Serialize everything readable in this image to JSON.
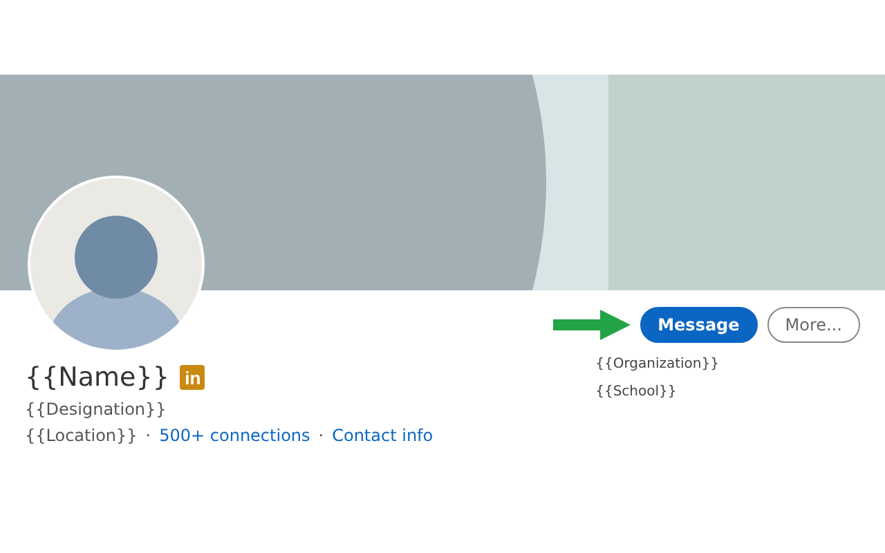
{
  "profile": {
    "name": "{{Name}}",
    "badge": "in",
    "designation": "{{Designation}}",
    "location": "{{Location}}",
    "separator_1": "·",
    "connections": "500+ connections",
    "separator_2": "·",
    "contact_info": "Contact info"
  },
  "actions": [
    {
      "label": "Message",
      "kind": "primary"
    },
    {
      "label": "More...",
      "kind": "secondary"
    }
  ],
  "details": [
    "{{Organization}}",
    "{{School}}"
  ]
}
